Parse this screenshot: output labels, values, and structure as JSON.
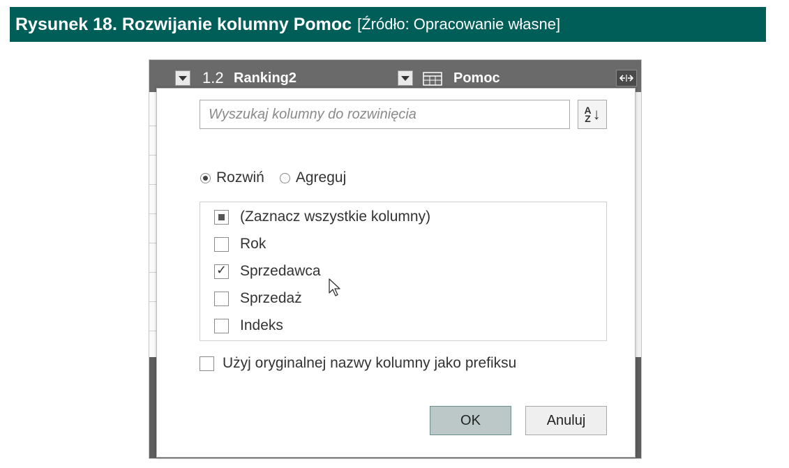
{
  "caption": {
    "figure_label": "Rysunek 18. Rozwijanie kolumny Pomoc",
    "source_note": "[Źródło: Opracowanie własne]"
  },
  "column_header": {
    "col1_type": "1.2",
    "col1_name": "Ranking2",
    "col2_name": "Pomoc",
    "expand_icon": "expand-columns-icon"
  },
  "dialog": {
    "search_placeholder": "Wyszukaj kolumny do rozwinięcia",
    "sort_icon": "sort-az-icon",
    "sort_az_top": "A",
    "sort_az_bottom": "Z",
    "sort_arrow": "↓",
    "radio_options": [
      {
        "label": "Rozwiń",
        "selected": true
      },
      {
        "label": "Agreguj",
        "selected": false
      }
    ],
    "columns": [
      {
        "label": "(Zaznacz wszystkie kolumny)",
        "state": "partial"
      },
      {
        "label": "Rok",
        "state": "unchecked"
      },
      {
        "label": "Sprzedawca",
        "state": "checked"
      },
      {
        "label": "Sprzedaż",
        "state": "unchecked"
      },
      {
        "label": "Indeks",
        "state": "unchecked"
      }
    ],
    "prefix_label": "Użyj oryginalnej nazwy kolumny jako prefiksu",
    "ok_label": "OK",
    "cancel_label": "Anuluj"
  },
  "colors": {
    "caption_bg": "#005e59",
    "header_bar": "#6a6a6a",
    "ok_button_bg": "#bcc8c8"
  }
}
